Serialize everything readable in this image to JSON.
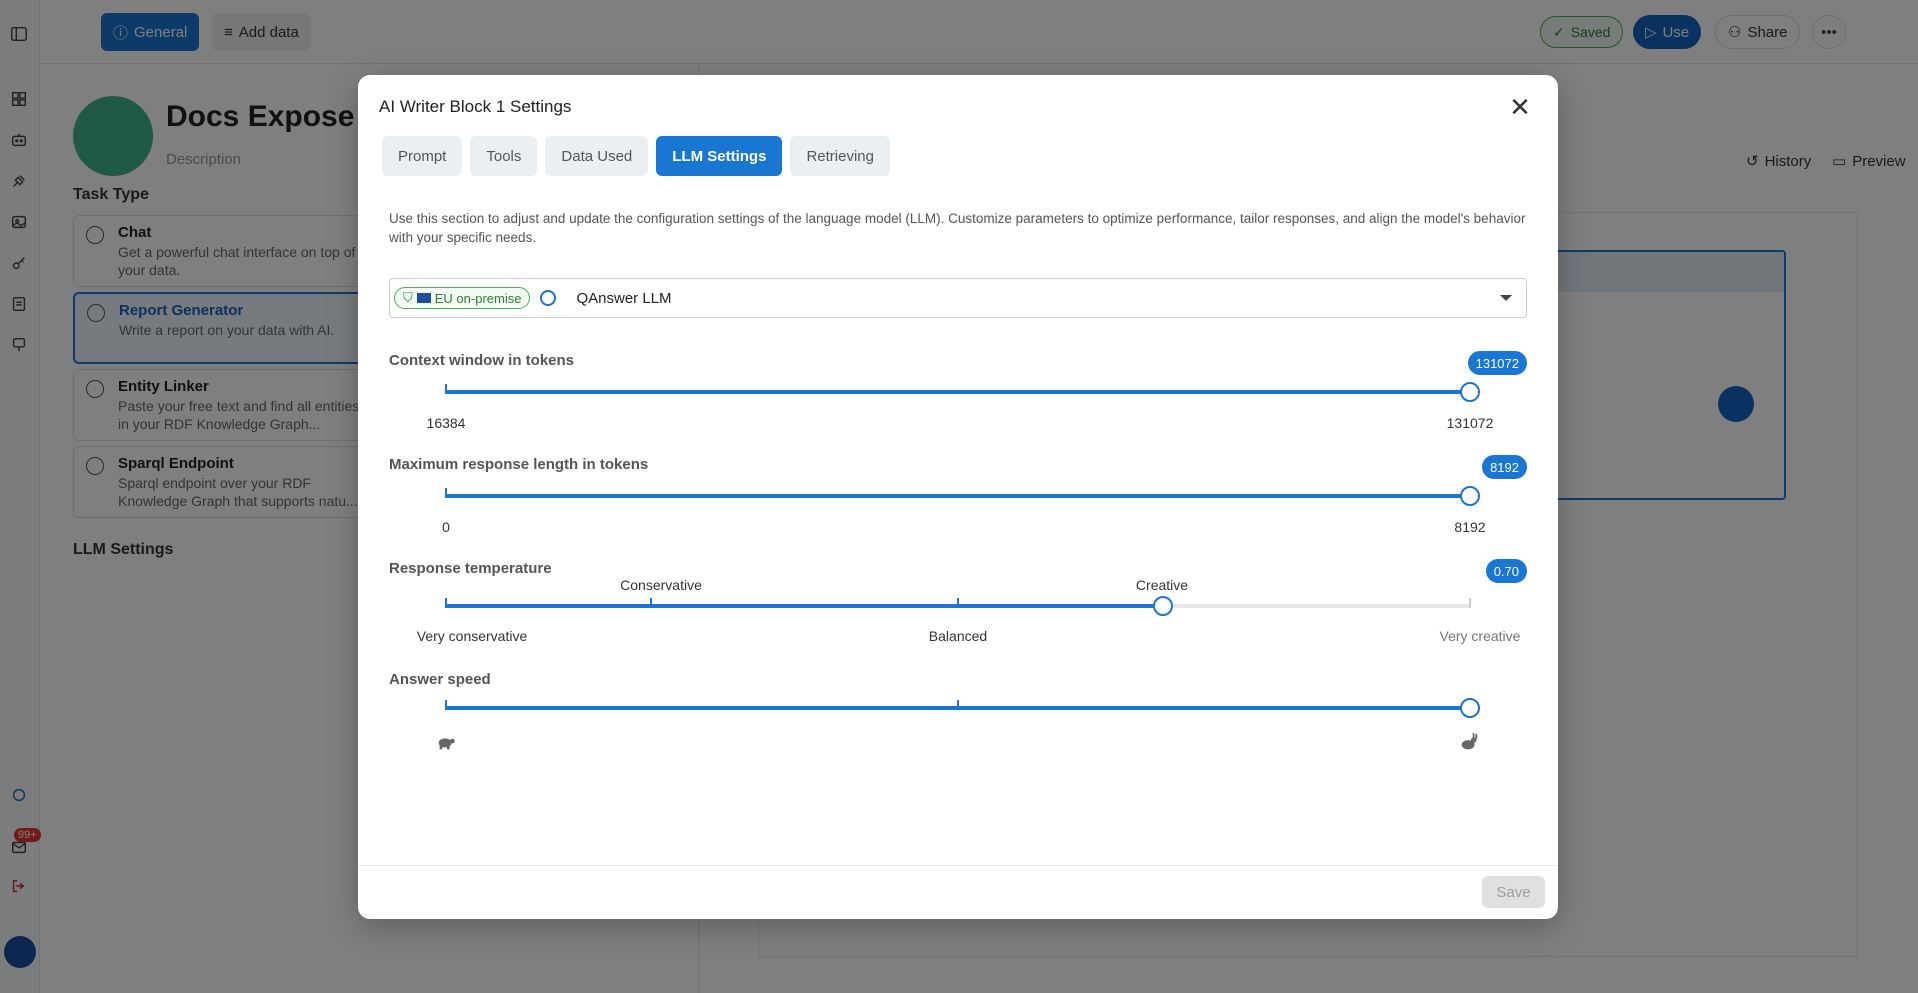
{
  "topbar": {
    "general_label": "General",
    "add_data_label": "Add data",
    "saved_label": "Saved",
    "use_label": "Use",
    "share_label": "Share"
  },
  "left_panel": {
    "title": "Docs Expose S",
    "description_placeholder": "Description",
    "task_type_label": "Task Type",
    "tasks": [
      {
        "title": "Chat",
        "desc": "Get a powerful chat interface on top of your data."
      },
      {
        "title": "Report Generator",
        "desc": "Write a report on your data with AI."
      },
      {
        "title": "Entity Linker",
        "desc": "Paste your free text and find all entities in your RDF Knowledge Graph..."
      },
      {
        "title": "Sparql Endpoint",
        "desc": "Sparql endpoint over your RDF Knowledge Graph that supports natu..."
      }
    ],
    "llm_settings_label": "LLM Settings"
  },
  "right_panel": {
    "history_label": "History",
    "preview_label": "Preview"
  },
  "notifications": {
    "badge": "99+"
  },
  "modal": {
    "title": "AI Writer Block 1 Settings",
    "tabs": [
      "Prompt",
      "Tools",
      "Data Used",
      "LLM Settings",
      "Retrieving"
    ],
    "active_tab": "LLM Settings",
    "intro": "Use this section to adjust and update the configuration settings of the language model (LLM). Customize parameters to optimize performance, tailor responses, and align the model's behavior with your specific needs.",
    "llm": {
      "badge": "EU on-premise",
      "model_name": "QAnswer LLM"
    },
    "context_window": {
      "label": "Context window in tokens",
      "value": "131072",
      "min_label": "16384",
      "max_label": "131072",
      "fraction": 1.0
    },
    "max_response": {
      "label": "Maximum response length in tokens",
      "value": "8192",
      "min_label": "0",
      "max_label": "8192",
      "fraction": 1.0
    },
    "temperature": {
      "label": "Response temperature",
      "value": "0.70",
      "fraction": 0.7,
      "marks_above": [
        "Conservative",
        "Creative"
      ],
      "marks_below": [
        "Very conservative",
        "Balanced",
        "Very creative"
      ]
    },
    "answer_speed": {
      "label": "Answer speed",
      "fraction": 1.0
    },
    "save_label": "Save"
  },
  "colors": {
    "accent": "#1976d2",
    "success": "#2e7d32"
  }
}
